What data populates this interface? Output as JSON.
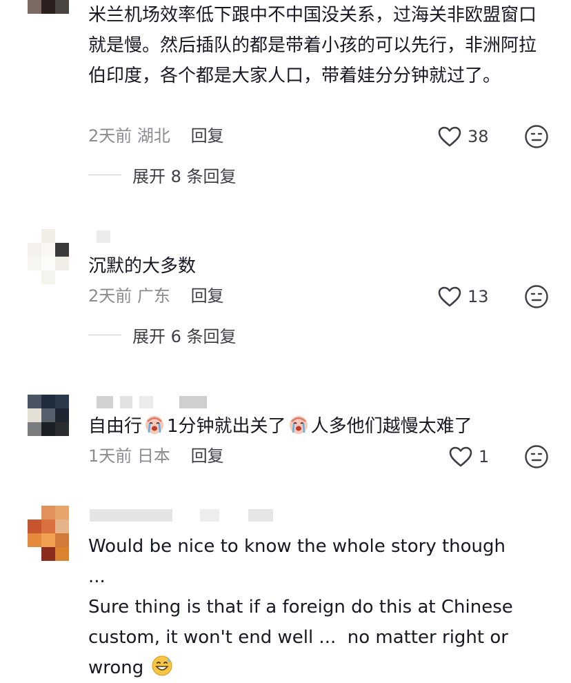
{
  "comments": [
    {
      "text": "米兰机场效率低下跟中不中国没关系，过海关非欧盟窗口就是慢。然后插队的都是带着小孩的可以先行，非洲阿拉伯印度，各个都是大家人口，带着娃分分钟就过了。",
      "time": "2天前",
      "location": "湖北",
      "reply_label": "回复",
      "likes": "38",
      "expand_label": "展开 8 条回复"
    },
    {
      "text": "沉默的大多数",
      "time": "2天前",
      "location": "广东",
      "reply_label": "回复",
      "likes": "13",
      "expand_label": "展开 6 条回复"
    },
    {
      "text_part1": "自由行",
      "text_part2": "1分钟就出关了",
      "text_part3": "人多他们越慢太难了",
      "time": "1天前",
      "location": "日本",
      "reply_label": "回复",
      "likes": "1"
    },
    {
      "text": "Would be nice to know the whole story though  ...\nSure thing is that if a foreign do this at Chinese custom, it won't end well ...  no matter right or wrong"
    }
  ],
  "icons": {
    "like": "heart-outline-icon",
    "dislike": "dislike-face-icon",
    "crying_emoji": "crying-face-emoji",
    "sweat_emoji": "grinning-sweat-emoji"
  },
  "colors": {
    "text": "#161823",
    "meta": "#8a8b91",
    "action": "#3d3d45"
  }
}
